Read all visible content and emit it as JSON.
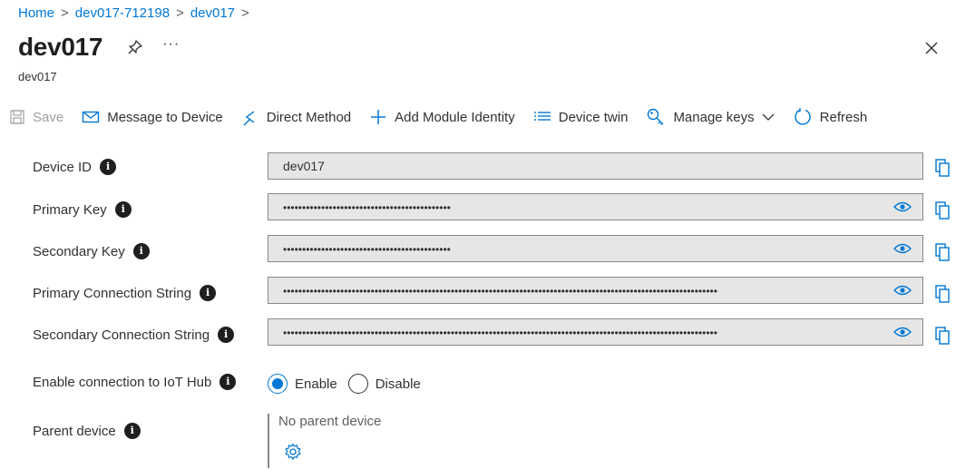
{
  "breadcrumb": [
    {
      "label": "Home"
    },
    {
      "label": "dev017-712198"
    },
    {
      "label": "dev017"
    }
  ],
  "breadcrumb_separator": ">",
  "title": "dev017",
  "subtitle": "dev017",
  "more_label": "···",
  "toolbar": {
    "save": "Save",
    "message": "Message to Device",
    "direct_method": "Direct Method",
    "add_module": "Add Module Identity",
    "device_twin": "Device twin",
    "manage_keys": "Manage keys",
    "refresh": "Refresh"
  },
  "fields": {
    "device_id": {
      "label": "Device ID",
      "value": "dev017"
    },
    "primary_key": {
      "label": "Primary Key",
      "value": "••••••••••••••••••••••••••••••••••••••••••••"
    },
    "secondary_key": {
      "label": "Secondary Key",
      "value": "••••••••••••••••••••••••••••••••••••••••••••"
    },
    "primary_conn": {
      "label": "Primary Connection String",
      "value": "••••••••••••••••••••••••••••••••••••••••••••••••••••••••••••••••••••••••••••••••••••••••••••••••••••••••••••••••••"
    },
    "secondary_conn": {
      "label": "Secondary Connection String",
      "value": "••••••••••••••••••••••••••••••••••••••••••••••••••••••••••••••••••••••••••••••••••••••••••••••••••••••••••••••••••"
    }
  },
  "connection": {
    "label": "Enable connection to IoT Hub",
    "enable": "Enable",
    "disable": "Disable",
    "selected": "Enable"
  },
  "parent": {
    "label": "Parent device",
    "value": "No parent device"
  },
  "info_glyph": "i",
  "colors": {
    "accent": "#0078d4",
    "field_bg": "#e6e6e6"
  }
}
